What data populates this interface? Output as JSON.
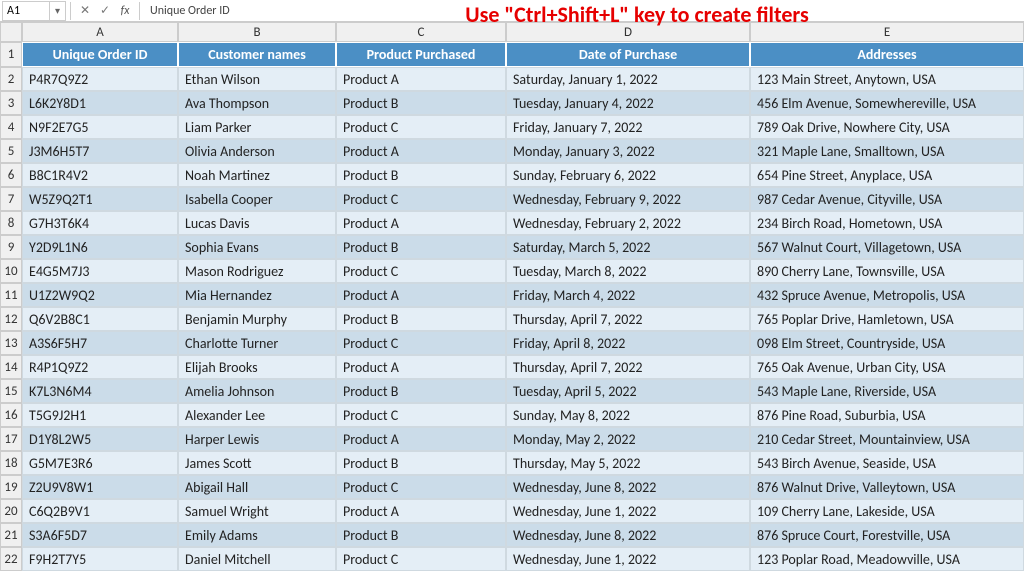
{
  "formula_bar": {
    "cell_ref": "A1",
    "fx_label": "fx",
    "content": "Unique Order ID"
  },
  "banner": "Use \"Ctrl+Shift+L\" key to create filters",
  "columns": [
    "A",
    "B",
    "C",
    "D",
    "E"
  ],
  "headers": [
    "Unique Order ID",
    "Customer names",
    "Product Purchased",
    "Date of Purchase",
    "Addresses"
  ],
  "rows": [
    {
      "n": "2",
      "id": "P4R7Q9Z2",
      "name": "Ethan Wilson",
      "prod": "Product A",
      "date": "Saturday, January 1, 2022",
      "addr": "123 Main Street, Anytown, USA"
    },
    {
      "n": "3",
      "id": "L6K2Y8D1",
      "name": "Ava Thompson",
      "prod": "Product B",
      "date": "Tuesday, January 4, 2022",
      "addr": "456 Elm Avenue, Somewhereville, USA"
    },
    {
      "n": "4",
      "id": "N9F2E7G5",
      "name": "Liam Parker",
      "prod": "Product C",
      "date": "Friday, January 7, 2022",
      "addr": "789 Oak Drive, Nowhere City, USA"
    },
    {
      "n": "5",
      "id": "J3M6H5T7",
      "name": "Olivia Anderson",
      "prod": "Product A",
      "date": "Monday, January 3, 2022",
      "addr": "321 Maple Lane, Smalltown, USA"
    },
    {
      "n": "6",
      "id": "B8C1R4V2",
      "name": "Noah Martinez",
      "prod": "Product B",
      "date": "Sunday, February 6, 2022",
      "addr": "654 Pine Street, Anyplace, USA"
    },
    {
      "n": "7",
      "id": "W5Z9Q2T1",
      "name": "Isabella Cooper",
      "prod": "Product C",
      "date": "Wednesday, February 9, 2022",
      "addr": "987 Cedar Avenue, Cityville, USA"
    },
    {
      "n": "8",
      "id": "G7H3T6K4",
      "name": "Lucas Davis",
      "prod": "Product A",
      "date": "Wednesday, February 2, 2022",
      "addr": "234 Birch Road, Hometown, USA"
    },
    {
      "n": "9",
      "id": "Y2D9L1N6",
      "name": "Sophia Evans",
      "prod": "Product B",
      "date": "Saturday, March 5, 2022",
      "addr": "567 Walnut Court, Villagetown, USA"
    },
    {
      "n": "10",
      "id": "E4G5M7J3",
      "name": "Mason Rodriguez",
      "prod": "Product C",
      "date": "Tuesday, March 8, 2022",
      "addr": "890 Cherry Lane, Townsville, USA"
    },
    {
      "n": "11",
      "id": "U1Z2W9Q2",
      "name": "Mia Hernandez",
      "prod": "Product A",
      "date": "Friday, March 4, 2022",
      "addr": "432 Spruce Avenue, Metropolis, USA"
    },
    {
      "n": "12",
      "id": "Q6V2B8C1",
      "name": "Benjamin Murphy",
      "prod": "Product B",
      "date": "Thursday, April 7, 2022",
      "addr": "765 Poplar Drive, Hamletown, USA"
    },
    {
      "n": "13",
      "id": "A3S6F5H7",
      "name": "Charlotte Turner",
      "prod": "Product C",
      "date": "Friday, April 8, 2022",
      "addr": "098 Elm Street, Countryside, USA"
    },
    {
      "n": "14",
      "id": "R4P1Q9Z2",
      "name": "Elijah Brooks",
      "prod": "Product A",
      "date": "Thursday, April 7, 2022",
      "addr": "765 Oak Avenue, Urban City, USA"
    },
    {
      "n": "15",
      "id": "K7L3N6M4",
      "name": "Amelia Johnson",
      "prod": "Product B",
      "date": "Tuesday, April 5, 2022",
      "addr": "543 Maple Lane, Riverside, USA"
    },
    {
      "n": "16",
      "id": "T5G9J2H1",
      "name": "Alexander Lee",
      "prod": "Product C",
      "date": "Sunday, May 8, 2022",
      "addr": "876 Pine Road, Suburbia, USA"
    },
    {
      "n": "17",
      "id": "D1Y8L2W5",
      "name": "Harper Lewis",
      "prod": "Product A",
      "date": "Monday, May 2, 2022",
      "addr": "210 Cedar Street, Mountainview, USA"
    },
    {
      "n": "18",
      "id": "G5M7E3R6",
      "name": "James Scott",
      "prod": "Product B",
      "date": "Thursday, May 5, 2022",
      "addr": "543 Birch Avenue, Seaside, USA"
    },
    {
      "n": "19",
      "id": "Z2U9V8W1",
      "name": "Abigail Hall",
      "prod": "Product C",
      "date": "Wednesday, June 8, 2022",
      "addr": "876 Walnut Drive, Valleytown, USA"
    },
    {
      "n": "20",
      "id": "C6Q2B9V1",
      "name": "Samuel Wright",
      "prod": "Product A",
      "date": "Wednesday, June 1, 2022",
      "addr": "109 Cherry Lane, Lakeside, USA"
    },
    {
      "n": "21",
      "id": "S3A6F5D7",
      "name": "Emily Adams",
      "prod": "Product B",
      "date": "Wednesday, June 8, 2022",
      "addr": "876 Spruce Court, Forestville, USA"
    },
    {
      "n": "22",
      "id": "F9H2T7Y5",
      "name": "Daniel Mitchell",
      "prod": "Product C",
      "date": "Wednesday, June 1, 2022",
      "addr": "123 Poplar Road, Meadowville, USA"
    }
  ]
}
